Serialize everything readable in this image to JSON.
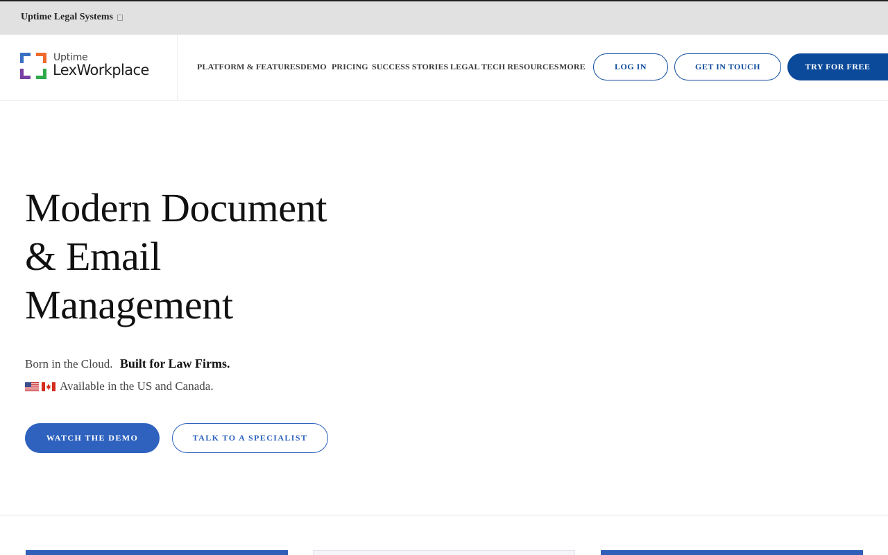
{
  "topbar": {
    "brand": "Uptime Legal Systems"
  },
  "logo": {
    "small": "Uptime",
    "big": "LexWorkplace"
  },
  "nav": [
    "PLATFORM & FEATURES",
    "DEMO",
    "PRICING",
    "SUCCESS STORIES",
    "LEGAL TECH RESOURCES",
    "MORE"
  ],
  "header_buttons": {
    "login": "LOG IN",
    "contact": "GET IN TOUCH",
    "trial": "TRY FOR FREE"
  },
  "hero": {
    "title_line1": "Modern Document",
    "title_line2": "& Email",
    "title_line3": "Management",
    "sub_plain": "Born in the Cloud.",
    "sub_bold": "Built for Law Firms.",
    "availability": "Available in the US and Canada.",
    "cta_primary": "WATCH THE DEMO",
    "cta_secondary": "TALK TO A SPECIALIST"
  },
  "colors": {
    "brand_blue": "#0b4a9a",
    "cta_blue": "#2e62be",
    "topbar_bg": "#e1e1e1"
  }
}
